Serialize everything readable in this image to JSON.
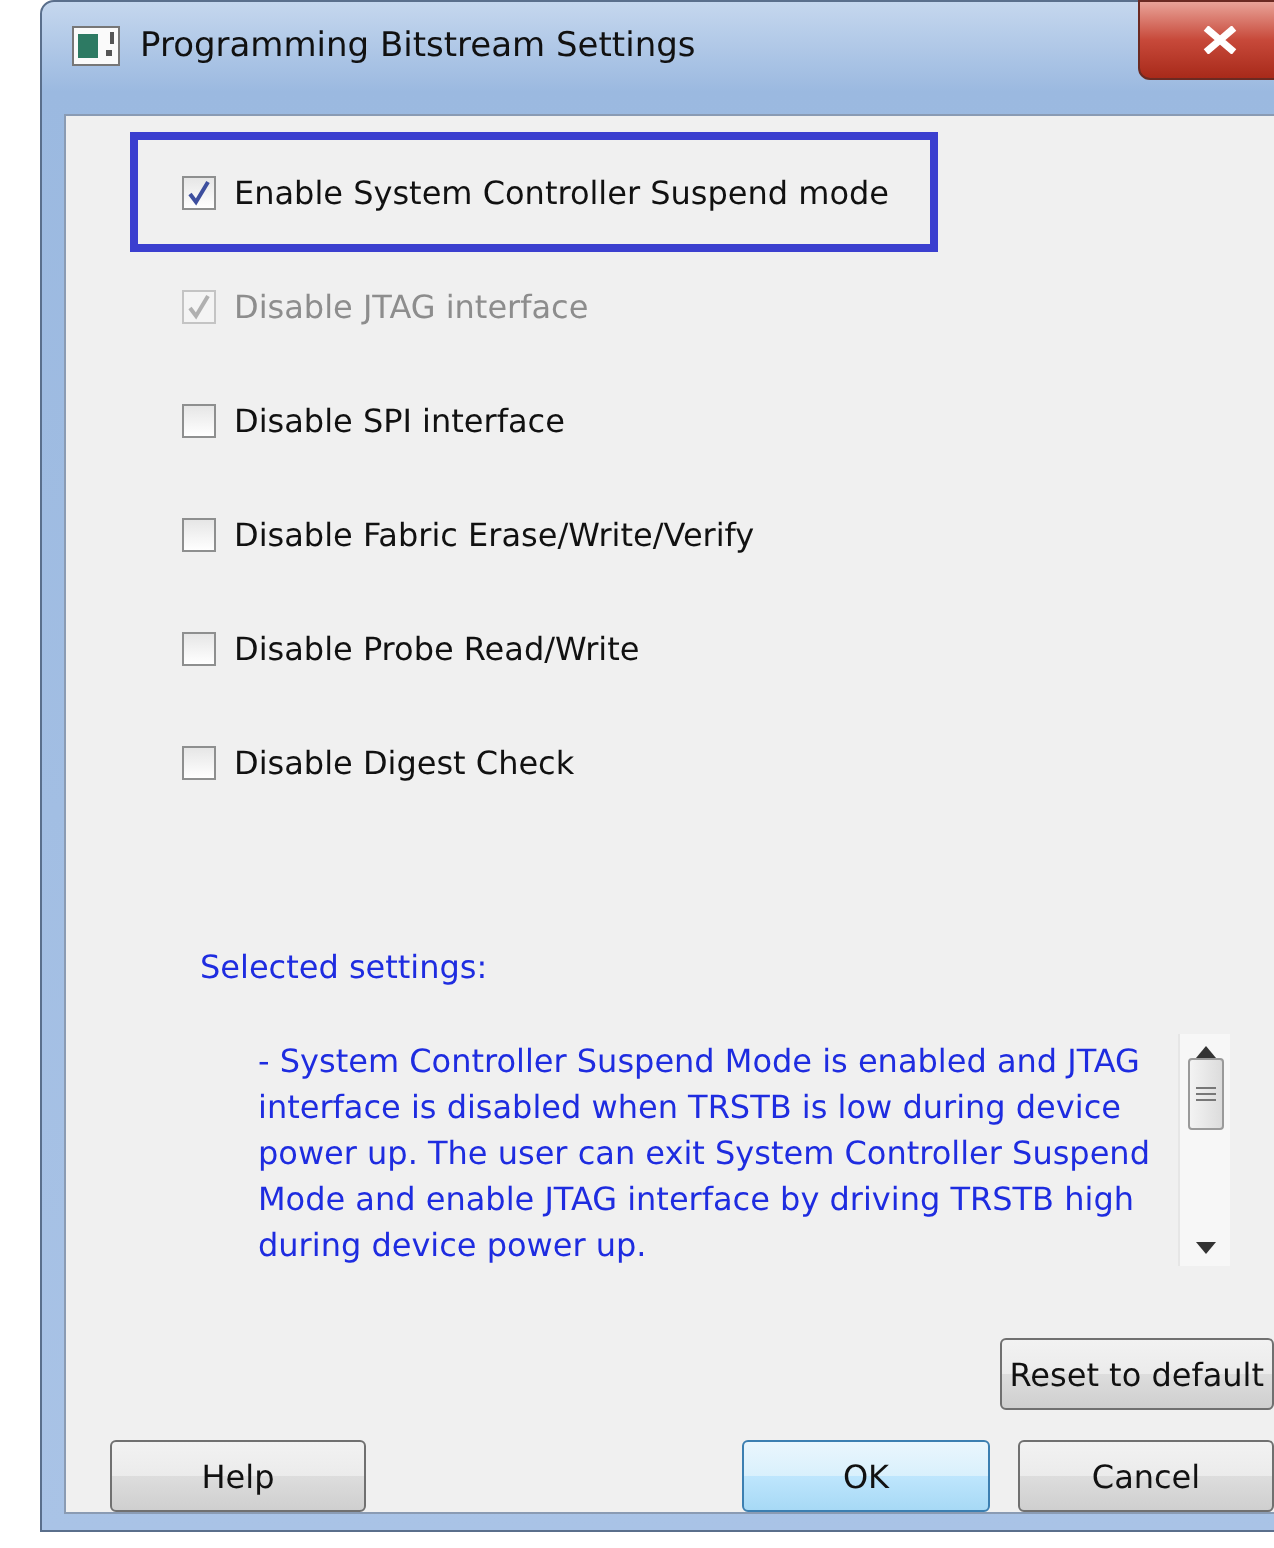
{
  "window": {
    "title": "Programming Bitstream Settings"
  },
  "options": [
    {
      "label": "Enable System Controller Suspend mode",
      "checked": true,
      "disabled": false,
      "highlighted": true
    },
    {
      "label": "Disable JTAG interface",
      "checked": true,
      "disabled": true,
      "highlighted": false
    },
    {
      "label": "Disable SPI interface",
      "checked": false,
      "disabled": false,
      "highlighted": false
    },
    {
      "label": "Disable Fabric Erase/Write/Verify",
      "checked": false,
      "disabled": false,
      "highlighted": false
    },
    {
      "label": "Disable Probe Read/Write",
      "checked": false,
      "disabled": false,
      "highlighted": false
    },
    {
      "label": "Disable Digest Check",
      "checked": false,
      "disabled": false,
      "highlighted": false
    }
  ],
  "selected_settings": {
    "heading": "Selected settings:",
    "text": "- System Controller Suspend Mode is enabled and JTAG interface is disabled when TRSTB is low during device power up. The user can exit System Controller Suspend Mode and enable JTAG interface by driving TRSTB high during device power up."
  },
  "buttons": {
    "reset": "Reset to default",
    "help": "Help",
    "ok": "OK",
    "cancel": "Cancel"
  }
}
